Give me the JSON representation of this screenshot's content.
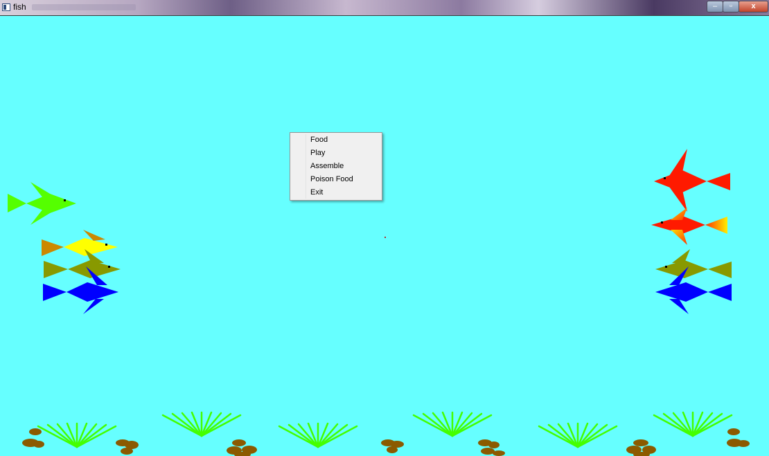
{
  "window": {
    "title": "fish",
    "background_color": "#66ffff",
    "controls": {
      "minimize": "–",
      "maximize": "▫",
      "close": "x"
    }
  },
  "context_menu": {
    "items": [
      "Food",
      "Play",
      "Assemble",
      "Poison Food",
      "Exit"
    ]
  },
  "fish": [
    {
      "name": "green",
      "facing": "right",
      "colors": [
        "#55ff00"
      ]
    },
    {
      "name": "yellow",
      "facing": "right",
      "colors": [
        "#ffff00",
        "#cc8800"
      ]
    },
    {
      "name": "olive-left",
      "facing": "right",
      "colors": [
        "#889900"
      ]
    },
    {
      "name": "blue-left",
      "facing": "right",
      "colors": [
        "#0000ff"
      ]
    },
    {
      "name": "red-top",
      "facing": "left",
      "colors": [
        "#ff1a00"
      ]
    },
    {
      "name": "red-gradient",
      "facing": "left",
      "colors": [
        "#ff1a00",
        "#ffcc00"
      ]
    },
    {
      "name": "olive-right",
      "facing": "left",
      "colors": [
        "#889900"
      ]
    },
    {
      "name": "blue-right",
      "facing": "left",
      "colors": [
        "#0000ff"
      ]
    }
  ],
  "decor": {
    "seaweed_color": "#44ff00",
    "rock_color": "#8b5a00"
  }
}
